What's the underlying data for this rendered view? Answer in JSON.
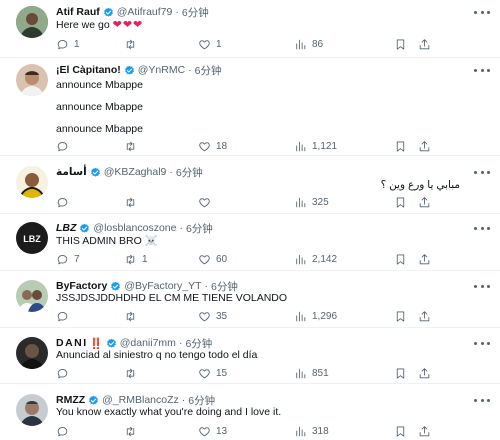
{
  "tweets": [
    {
      "name": "Atif Rauf",
      "handle": "@Atifrauf79",
      "time": "6分钟",
      "text": "Here we go ",
      "hearts": "❤❤❤",
      "replies": "1",
      "retweets": "",
      "likes": "1",
      "views": "86",
      "avatar_color": "#5a7d5a"
    },
    {
      "name": "¡El Càpitano!",
      "handle": "@YnRMC",
      "time": "6分钟",
      "lines": [
        "announce Mbappe",
        "announce Mbappe",
        "announce Mbappe"
      ],
      "replies": "",
      "retweets": "",
      "likes": "18",
      "views": "1,121",
      "avatar_color": "#c9a78e"
    },
    {
      "name": "أسامة",
      "handle": "@KBZaghal9",
      "time": "6分钟",
      "text": "مبابي يا ورع وين ؟",
      "replies": "",
      "retweets": "",
      "likes": "",
      "views": "325",
      "avatar_color": "#e2b400"
    },
    {
      "name": "LBZ",
      "handle": "@losblancoszone",
      "time": "6分钟",
      "text": "THIS ADMIN BRO ☠️",
      "replies": "7",
      "retweets": "1",
      "likes": "60",
      "views": "2,142",
      "avatar_color": "#1b1b1b"
    },
    {
      "name": "ByFactory",
      "handle": "@ByFactory_YT",
      "time": "6分钟",
      "text": "JSSJDSJDDHDHD EL CM ME TIENE VOLANDO",
      "replies": "",
      "retweets": "",
      "likes": "35",
      "views": "1,296",
      "avatar_color": "#7a9a7a"
    },
    {
      "name": "DANI",
      "name_badge": "‼️",
      "handle": "@danii7mm",
      "time": "6分钟",
      "text": "Anunciad al siniestro q no tengo todo el día",
      "replies": "",
      "retweets": "",
      "likes": "15",
      "views": "851",
      "avatar_color": "#3a3a3a"
    },
    {
      "name": "RMZZ",
      "handle": "@_RMBlancoZz",
      "time": "6分钟",
      "text": "You know exactly what you're doing and I love it.",
      "replies": "",
      "retweets": "",
      "likes": "13",
      "views": "318",
      "avatar_color": "#8a8f96"
    }
  ],
  "colors": {
    "verified": "#1d9bf0",
    "secondary": "#536471",
    "primary": "#0f1419",
    "heart": "#e0245e"
  },
  "icons": [
    "reply-icon",
    "retweet-icon",
    "like-icon",
    "views-icon",
    "bookmark-icon",
    "share-icon",
    "more-icon",
    "verified-icon"
  ]
}
